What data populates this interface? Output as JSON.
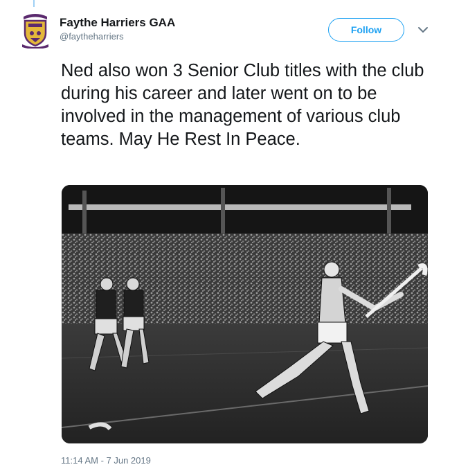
{
  "tweet": {
    "account": {
      "display_name": "Faythe Harriers GAA",
      "handle": "@faytheharriers",
      "avatar_icon": "club-crest-icon"
    },
    "follow_label": "Follow",
    "menu_icon": "chevron-down-icon",
    "text": "Ned also won 3 Senior Club titles with the club during his career and later went on to be involved in the management of various club teams. May He Rest In Peace.",
    "timestamp": "11:14 AM - 7 Jun 2019"
  },
  "colors": {
    "accent": "#1da1f2",
    "text": "#14171a",
    "muted": "#657786",
    "crest_purple": "#5b2a6e",
    "crest_gold": "#e4b83a"
  }
}
